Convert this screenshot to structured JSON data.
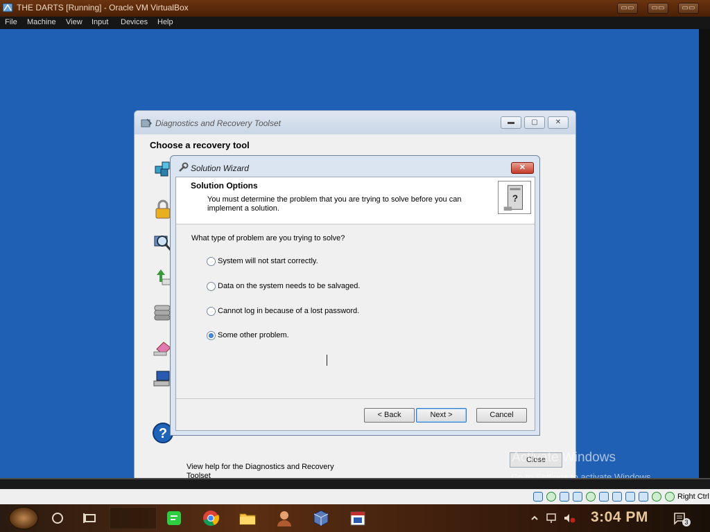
{
  "host": {
    "title": "THE DARTS [Running] - Oracle VM VirtualBox",
    "menu": [
      "File",
      "Machine",
      "View",
      "Input",
      "Devices",
      "Help"
    ],
    "right_ctrl_label": "Right Ctrl"
  },
  "dart": {
    "title": "Diagnostics and Recovery Toolset",
    "heading": "Choose a recovery tool",
    "help_text": "View help for the Diagnostics and Recovery Toolset",
    "close_label": "Close",
    "tool_icons": [
      "registry-cubes-icon",
      "locksmith-lock-icon",
      "crash-analyzer-magnifier-icon",
      "file-restore-icon",
      "disk-commander-icon",
      "disk-wipe-eraser-icon",
      "computer-management-icon"
    ]
  },
  "watermark": {
    "line1": "Activate Windows",
    "line2": "Go to Settings to activate Windows."
  },
  "wizard": {
    "title": "Solution Wizard",
    "close_glyph": "✕",
    "header_title": "Solution Options",
    "header_desc": "You must determine the problem that you are trying to solve before you can implement a solution.",
    "question": "What type of problem are you trying to solve?",
    "options": [
      {
        "label": "System will not start correctly.",
        "selected": false
      },
      {
        "label": "Data on the system needs to be salvaged.",
        "selected": false
      },
      {
        "label": "Cannot log in because of a lost password.",
        "selected": false
      },
      {
        "label": "Some other problem.",
        "selected": true
      }
    ],
    "buttons": {
      "back": "< Back",
      "next": "Next >",
      "cancel": "Cancel"
    }
  },
  "taskbar": {
    "clock": "3:04 PM",
    "notification_count": "3",
    "pinned": [
      "task-view-icon",
      "sticky-notes-icon",
      "chrome-icon",
      "file-explorer-icon",
      "user-app-icon",
      "virtualbox-icon",
      "calendar-app-icon"
    ]
  },
  "colors": {
    "guest_desktop": "#1f5fb4",
    "host_title_bar": "#5a2a0c",
    "clock": "#e8c89a"
  }
}
